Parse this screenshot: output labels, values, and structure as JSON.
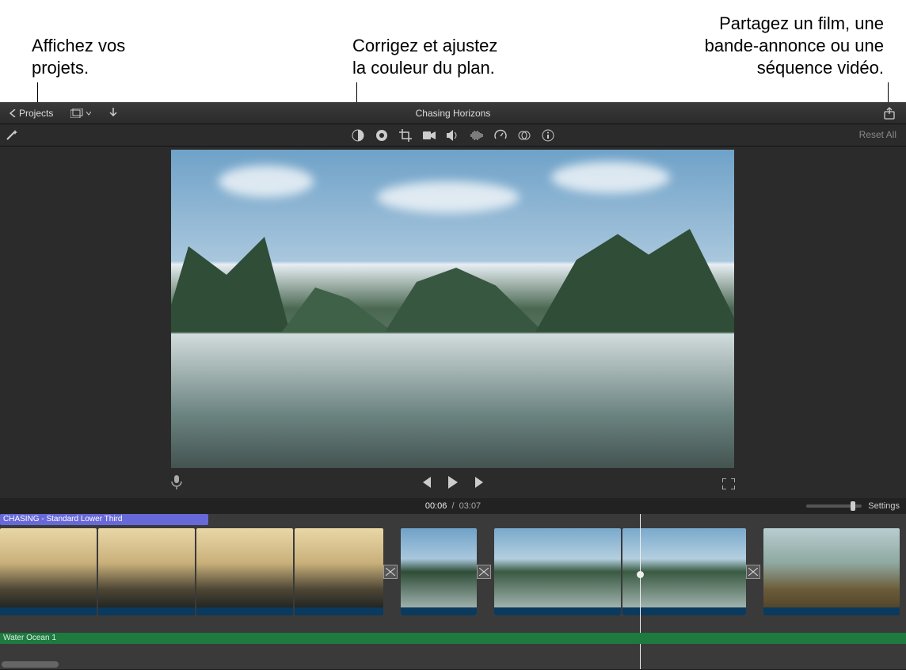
{
  "annotations": {
    "left": "Affichez vos\nprojets.",
    "center": "Corrigez et ajustez\nla couleur du plan.",
    "right": "Partagez un film, une\nbande-annonce ou une\nséquence vidéo."
  },
  "toolbar": {
    "projects_label": "Projects",
    "title": "Chasing Horizons"
  },
  "adjust": {
    "reset_label": "Reset All"
  },
  "playback": {
    "current_time": "00:06",
    "separator": "/",
    "total_time": "03:07",
    "settings_label": "Settings"
  },
  "timeline": {
    "title_clip_label": "CHASING - Standard Lower Third",
    "audio_track_label": "Water Ocean 1"
  }
}
